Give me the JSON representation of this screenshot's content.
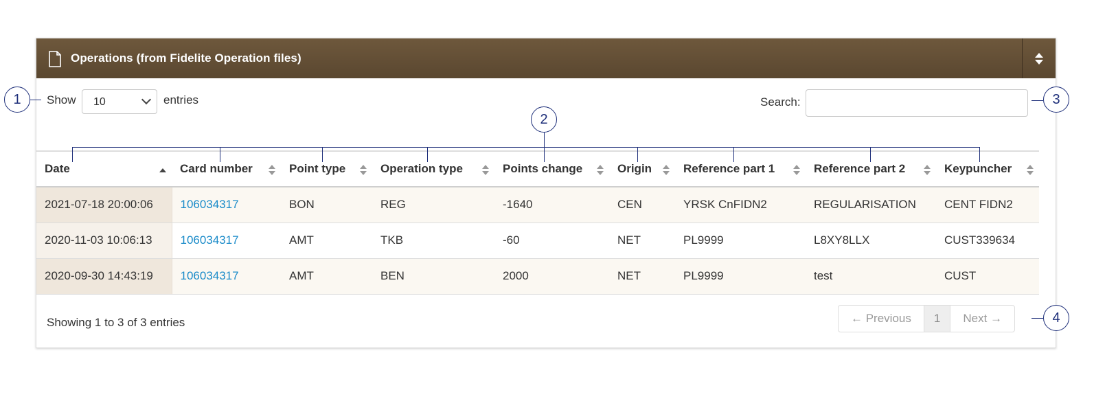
{
  "panel": {
    "title": "Operations (from Fidelite Operation files)",
    "icon": "document-icon",
    "colors": {
      "header": "#5a4730",
      "link": "#1a8bc9",
      "callout": "#1e2f7a"
    }
  },
  "controls": {
    "show_label": "Show",
    "entries_value": "10",
    "entries_label": "entries",
    "search_label": "Search:",
    "search_value": ""
  },
  "table": {
    "columns": [
      "Date",
      "Card number",
      "Point type",
      "Operation type",
      "Points change",
      "Origin",
      "Reference part 1",
      "Reference part 2",
      "Keypuncher"
    ],
    "sorted_column": "Date",
    "sort_direction": "ascending",
    "rows": [
      [
        "2021-07-18 20:00:06",
        "106034317",
        "BON",
        "REG",
        "-1640",
        "CEN",
        "YRSK CnFIDN2",
        "REGULARISATION",
        "CENT FIDN2"
      ],
      [
        "2020-11-03 10:06:13",
        "106034317",
        "AMT",
        "TKB",
        "-60",
        "NET",
        "PL9999",
        "L8XY8LLX",
        "CUST339634"
      ],
      [
        "2020-09-30 14:43:19",
        "106034317",
        "AMT",
        "BEN",
        "2000",
        "NET",
        "PL9999",
        "test",
        "CUST"
      ]
    ]
  },
  "footer": {
    "info": "Showing 1 to 3 of 3 entries",
    "previous": "← Previous",
    "current_page": "1",
    "next": "Next →"
  },
  "callouts": [
    "1",
    "2",
    "3",
    "4"
  ]
}
